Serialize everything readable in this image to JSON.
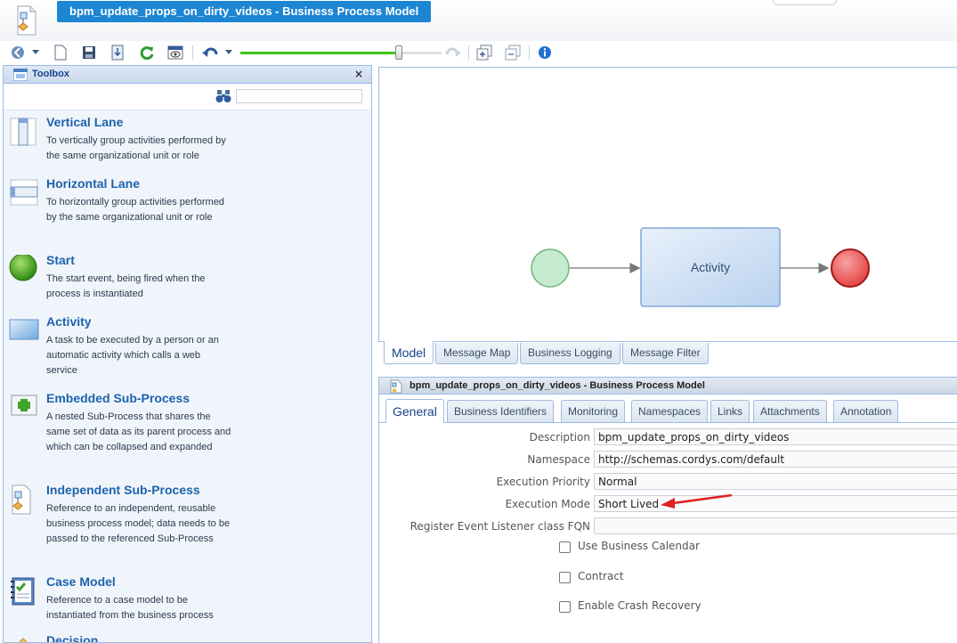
{
  "window": {
    "title": "bpm_update_props_on_dirty_videos - Business Process Model"
  },
  "toolbar": {
    "icons": [
      "back-icon",
      "dropdown-icon",
      "new-document-icon",
      "save-icon",
      "export-icon",
      "refresh-icon",
      "preview-icon",
      "undo-icon",
      "dropdown-icon",
      "redo-icon",
      "expand-icon",
      "collapse-icon",
      "info-icon"
    ],
    "zoom_level": 0.7
  },
  "toolbox": {
    "title": "Toolbox",
    "close": "×",
    "search_value": "",
    "items": [
      {
        "name": "Vertical Lane",
        "icon": "vertical-lane-icon",
        "desc": "To vertically group activities performed by the same organizational unit or role"
      },
      {
        "name": "Horizontal Lane",
        "icon": "horizontal-lane-icon",
        "desc": "To horizontally group activities performed by the same organizational unit or role"
      },
      {
        "name": "Start",
        "icon": "start-event-icon",
        "desc": "The start event, being fired when the process is instantiated"
      },
      {
        "name": "Activity",
        "icon": "activity-icon",
        "desc": "A task to be executed by a person or an automatic activity which calls a web service"
      },
      {
        "name": "Embedded Sub-Process",
        "icon": "embedded-subprocess-icon",
        "desc": "A nested Sub-Process that shares the same set of data as its parent process and which can be collapsed and expanded"
      },
      {
        "name": "Independent Sub-Process",
        "icon": "independent-subprocess-icon",
        "desc": "Reference to an independent, reusable business process model; data needs to be passed to the referenced Sub-Process"
      },
      {
        "name": "Case Model",
        "icon": "case-model-icon",
        "desc": "Reference to a case model to be instantiated from the business process"
      },
      {
        "name": "Decision",
        "icon": "decision-icon",
        "desc": ""
      }
    ]
  },
  "canvas": {
    "activity_label": "Activity",
    "colors": {
      "start": "#b9e6c4",
      "end": "#ef5b5b",
      "activity": "#cfe0f4"
    }
  },
  "model_tabs": [
    "Model",
    "Message Map",
    "Business Logging",
    "Message Filter"
  ],
  "properties": {
    "title": "bpm_update_props_on_dirty_videos - Business Process Model",
    "tabs": [
      "General",
      "Business Identifiers",
      "Monitoring",
      "Namespaces",
      "Links",
      "Attachments",
      "Annotation"
    ],
    "fields": [
      {
        "label": "Description",
        "value": "bpm_update_props_on_dirty_videos"
      },
      {
        "label": "Namespace",
        "value": "http://schemas.cordys.com/default"
      },
      {
        "label": "Execution Priority",
        "value": "Normal"
      },
      {
        "label": "Execution Mode",
        "value": "Short Lived"
      },
      {
        "label": "Register Event Listener class FQN",
        "value": ""
      }
    ],
    "checkboxes": [
      {
        "label": "Use Business Calendar",
        "checked": false
      },
      {
        "label": "Contract",
        "checked": false
      },
      {
        "label": "Enable Crash Recovery",
        "checked": false
      }
    ]
  }
}
